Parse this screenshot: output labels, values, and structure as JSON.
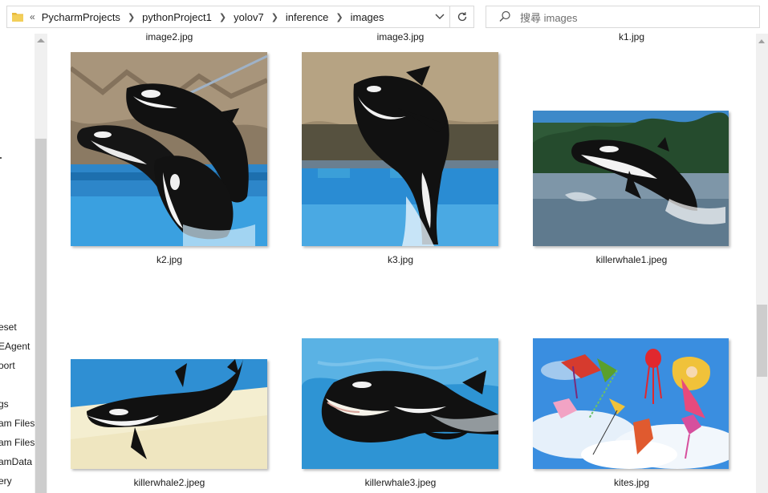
{
  "address": {
    "overflow": "«",
    "crumbs": [
      "PycharmProjects",
      "pythonProject1",
      "yolov7",
      "inference",
      "images"
    ]
  },
  "search": {
    "placeholder": "搜尋 images"
  },
  "left_nav": [
    "eset",
    "EAgent",
    "oort",
    "gs",
    "am Files",
    "am Files",
    "amData",
    "ery"
  ],
  "top_row_labels": [
    "image2.jpg",
    "image3.jpg",
    "k1.jpg"
  ],
  "files": [
    {
      "name": "k2.jpg"
    },
    {
      "name": "k3.jpg"
    },
    {
      "name": "killerwhale1.jpeg"
    },
    {
      "name": "killerwhale2.jpeg"
    },
    {
      "name": "killerwhale3.jpeg"
    },
    {
      "name": "kites.jpg"
    }
  ],
  "colors": {
    "folder": "#e8b93a",
    "water": "#2a8fd6",
    "sky": "#3a8ee0",
    "orca_black": "#111111"
  }
}
